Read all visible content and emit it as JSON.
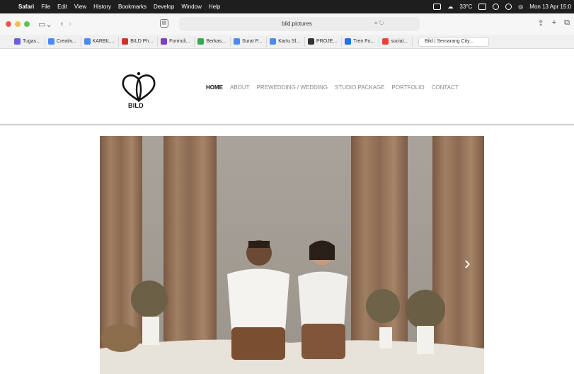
{
  "menubar": {
    "app": "Safari",
    "items": [
      "File",
      "Edit",
      "View",
      "History",
      "Bookmarks",
      "Develop",
      "Window",
      "Help"
    ],
    "status": {
      "temperature": "33°C",
      "datetime": "Mon 13 Apr 15:0"
    }
  },
  "toolbar": {
    "url": "bild.pictures"
  },
  "bookmarks": [
    {
      "label": "Tugas...",
      "color": "#6c5ce7"
    },
    {
      "label": "Creativ...",
      "color": "#4a8af4"
    },
    {
      "label": "KARBIL...",
      "color": "#4a8af4"
    },
    {
      "label": "BILD Ph...",
      "color": "#d93025"
    },
    {
      "label": "Formuli...",
      "color": "#7b3fc4"
    },
    {
      "label": "Berkas...",
      "color": "#34a853"
    },
    {
      "label": "Surat P...",
      "color": "#4a8af4"
    },
    {
      "label": "Kartu Sl...",
      "color": "#4a8af4"
    },
    {
      "label": "PROJE...",
      "color": "#333333"
    },
    {
      "label": "Tren Fo...",
      "color": "#1a73e8"
    },
    {
      "label": "social...",
      "color": "#ea4335"
    }
  ],
  "active_tab": "Bild | Semarang City...",
  "site": {
    "logo_text": "BILD",
    "nav": [
      "HOME",
      "ABOUT",
      "PREWEDDING / WEDDING",
      "STUDIO PACKAGE",
      "PORTFOLIO",
      "CONTACT"
    ]
  },
  "hero": {
    "next_arrow": "›"
  }
}
